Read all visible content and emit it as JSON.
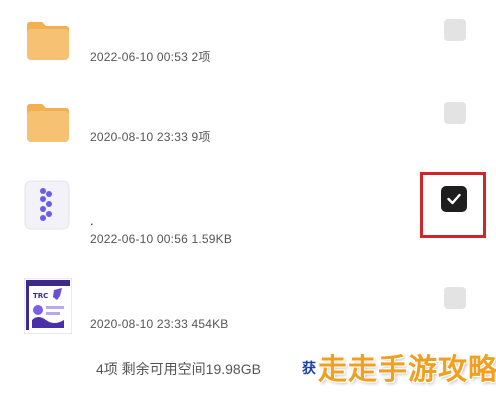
{
  "files": [
    {
      "type": "folder",
      "meta": "2022-06-10 00:53  2项",
      "checked": false,
      "icon": "folder-icon"
    },
    {
      "type": "folder",
      "meta": "2020-08-10 23:33  9项",
      "checked": false,
      "icon": "folder-icon"
    },
    {
      "type": "app",
      "name": ".",
      "meta": "2022-06-10 00:56  1.59KB",
      "checked": true,
      "icon": "app-file-icon"
    },
    {
      "type": "image",
      "meta": "2020-08-10 23:33  454KB",
      "checked": false,
      "icon": "image-thumbnail"
    }
  ],
  "footer": {
    "summary": "4项 剩余可用空间19.98GB",
    "get_more": "获"
  },
  "watermark": "走走手游攻略",
  "colors": {
    "folder": "#f7c173",
    "folder_tab": "#f2b04e",
    "checkbox": "#e3e3e3",
    "checkbox_checked": "#1e1e1e",
    "highlight": "#d0262a",
    "link": "#1c3fae",
    "watermark": "#f0a020",
    "app_accent": "#6b5ce7"
  }
}
